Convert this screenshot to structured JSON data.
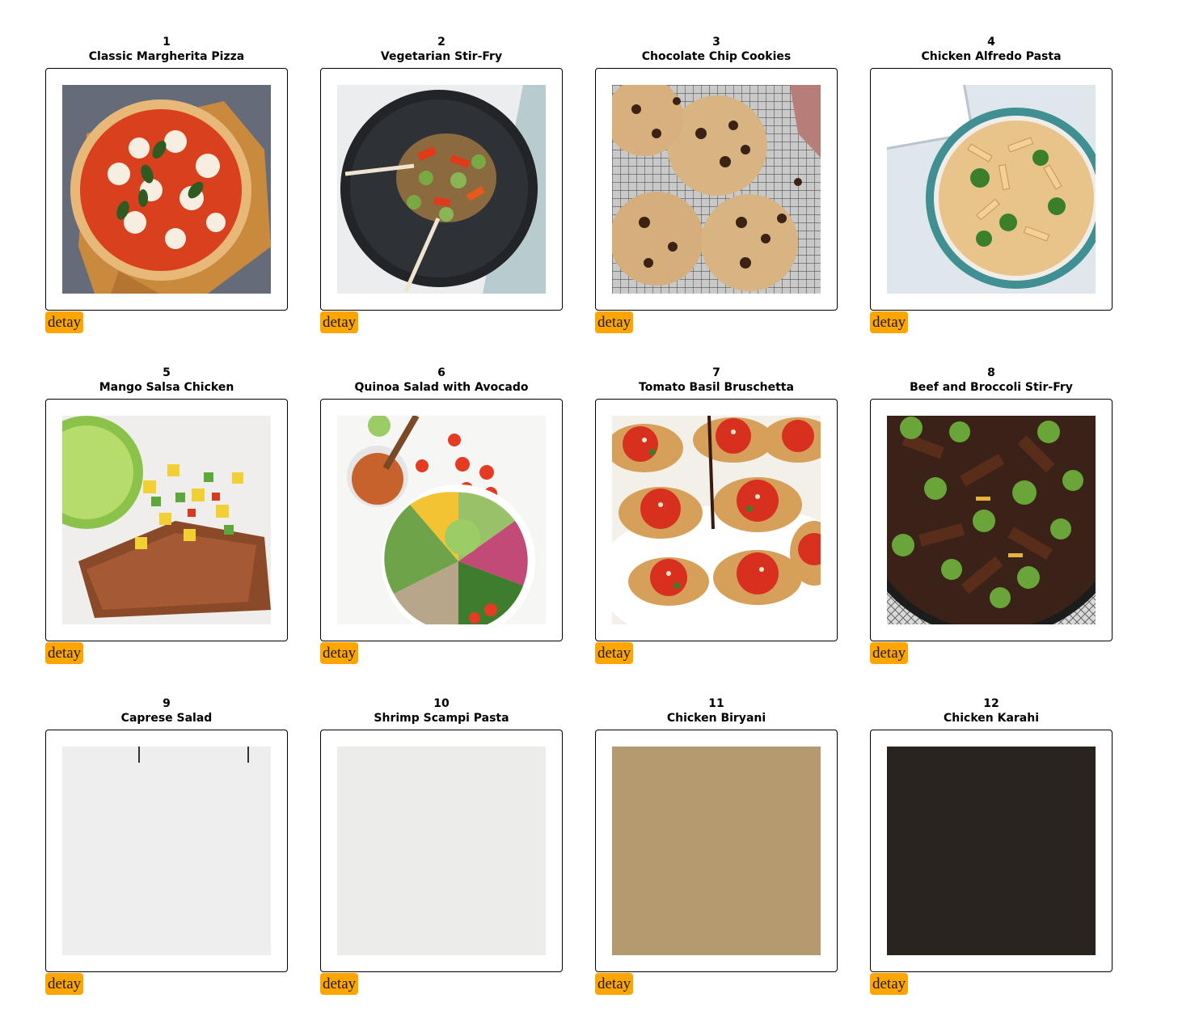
{
  "recipes": [
    {
      "number": "1",
      "title": "Classic Margherita Pizza",
      "button_label": "detay",
      "image": "margherita-pizza-photo"
    },
    {
      "number": "2",
      "title": "Vegetarian Stir-Fry",
      "button_label": "detay",
      "image": "vegetable-stir-fry-photo"
    },
    {
      "number": "3",
      "title": "Chocolate Chip Cookies",
      "button_label": "detay",
      "image": "chocolate-chip-cookies-photo"
    },
    {
      "number": "4",
      "title": "Chicken Alfredo Pasta",
      "button_label": "detay",
      "image": "chicken-alfredo-pasta-photo"
    },
    {
      "number": "5",
      "title": "Mango Salsa Chicken",
      "button_label": "detay",
      "image": "mango-salsa-chicken-photo"
    },
    {
      "number": "6",
      "title": "Quinoa Salad with Avocado",
      "button_label": "detay",
      "image": "quinoa-avocado-salad-photo"
    },
    {
      "number": "7",
      "title": "Tomato Basil Bruschetta",
      "button_label": "detay",
      "image": "bruschetta-photo"
    },
    {
      "number": "8",
      "title": "Beef and Broccoli Stir-Fry",
      "button_label": "detay",
      "image": "beef-broccoli-photo"
    },
    {
      "number": "9",
      "title": "Caprese Salad",
      "button_label": "detay",
      "image": "caprese-salad-photo"
    },
    {
      "number": "10",
      "title": "Shrimp Scampi Pasta",
      "button_label": "detay",
      "image": "shrimp-scampi-photo"
    },
    {
      "number": "11",
      "title": "Chicken Biryani",
      "button_label": "detay",
      "image": "chicken-biryani-photo"
    },
    {
      "number": "12",
      "title": "Chicken Karahi",
      "button_label": "detay",
      "image": "chicken-karahi-photo"
    }
  ],
  "colors": {
    "button_bg": "#ffa500",
    "card_border": "#000000",
    "page_bg": "#ffffff"
  }
}
